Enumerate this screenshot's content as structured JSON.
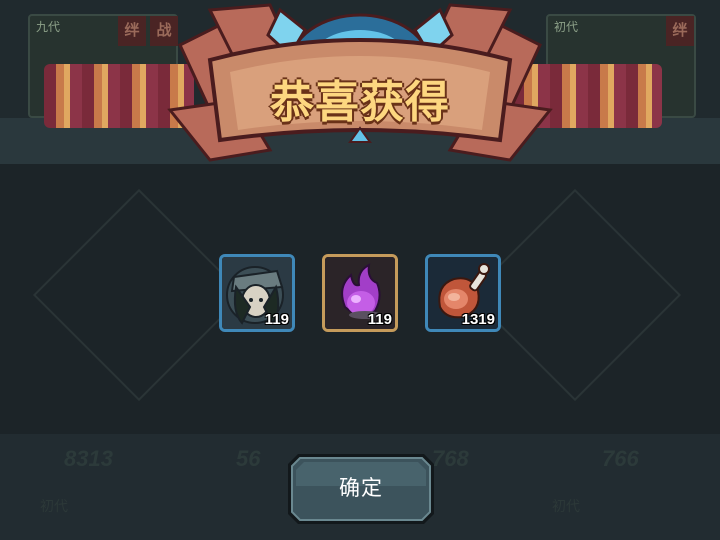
{
  "dialog": {
    "title": "恭喜获得",
    "confirm_label": "确定"
  },
  "rewards": [
    {
      "name": "hero-portrait",
      "count": "119",
      "frame": "blue",
      "icon": "hero-portrait-icon"
    },
    {
      "name": "purple-soul-orb",
      "count": "119",
      "frame": "gold",
      "icon": "purple-soul-icon"
    },
    {
      "name": "ham-leg",
      "count": "1319",
      "frame": "blue",
      "icon": "ham-leg-icon"
    }
  ],
  "background": {
    "card_tags": [
      "九代",
      "初代",
      "初代",
      "初代"
    ],
    "card_badges": [
      "绊",
      "战",
      "绊"
    ],
    "powers": [
      "8313",
      "56",
      "768",
      "766"
    ]
  },
  "colors": {
    "title": "#fdd780",
    "frame_blue": "#3f88b8",
    "frame_gold": "#c59b5b",
    "button": "#3c535c"
  }
}
